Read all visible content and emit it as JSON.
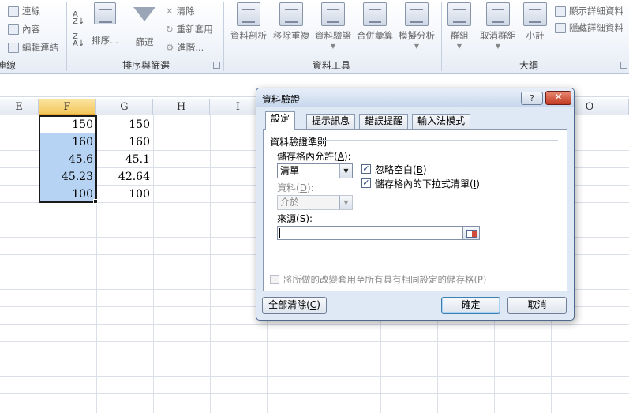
{
  "ribbon": {
    "connections_group": {
      "items": [
        "連線",
        "內容",
        "編輯連結"
      ],
      "label": "連線"
    },
    "sort_filter_group": {
      "sort_label": "排序...",
      "filter_label": "篩選",
      "clear_label": "清除",
      "reapply_label": "重新套用",
      "advanced_label": "進階...",
      "label": "排序與篩選"
    },
    "data_tools_group": {
      "buttons": [
        "資料剖析",
        "移除重複",
        "資料驗證",
        "合併彙算",
        "模擬分析"
      ],
      "label": "資料工具"
    },
    "outline_group": {
      "buttons": [
        "群組",
        "取消群組",
        "小計"
      ],
      "show_detail": "顯示詳細資料",
      "hide_detail": "隱藏詳細資料",
      "label": "大綱"
    }
  },
  "sheet": {
    "columns": [
      "E",
      "F",
      "G",
      "H",
      "I",
      "O"
    ],
    "selected_column": "F",
    "col_f_values": [
      "150",
      "160",
      "45.6",
      "45.23",
      "100"
    ],
    "col_g_values": [
      "150",
      "160",
      "45.1",
      "42.64",
      "100"
    ]
  },
  "dialog": {
    "title": "資料驗證",
    "help_glyph": "?",
    "close_glyph": "✕",
    "tabs": [
      "設定",
      "提示訊息",
      "錯誤提醒",
      "輸入法模式"
    ],
    "active_tab": "設定",
    "criteria_heading": "資料驗證準則",
    "allow_label_pre": "儲存格內允許(",
    "allow_label_key": "A",
    "allow_label_post": "):",
    "allow_value": "清單",
    "ignore_blank_pre": "忽略空白(",
    "ignore_blank_key": "B",
    "ignore_blank_post": ")",
    "ignore_blank_checked": true,
    "in_cell_dropdown_pre": "儲存格內的下拉式清單(",
    "in_cell_dropdown_key": "I",
    "in_cell_dropdown_post": ")",
    "in_cell_dropdown_checked": true,
    "data_label_pre": "資料(",
    "data_label_key": "D",
    "data_label_post": "):",
    "data_value": "介於",
    "source_label_pre": "來源(",
    "source_label_key": "S",
    "source_label_post": "):",
    "source_value": "",
    "apply_all_label": "將所做的改變套用至所有具有相同設定的儲存格(P)",
    "clear_all_pre": "全部清除(",
    "clear_all_key": "C",
    "clear_all_post": ")",
    "ok_label": "確定",
    "cancel_label": "取消"
  }
}
